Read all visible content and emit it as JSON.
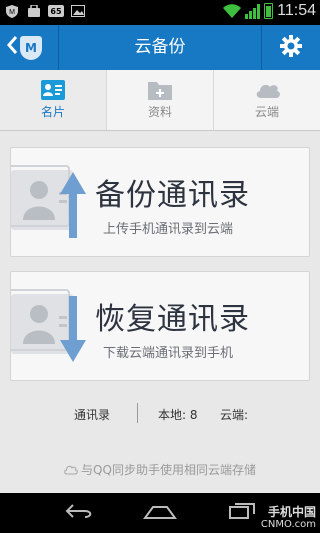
{
  "status_bar": {
    "time": "11:54",
    "badge_text": "65"
  },
  "header": {
    "title": "云备份",
    "logo_text": "M",
    "back_icon": "chevron-left-icon",
    "settings_icon": "gear-icon"
  },
  "tabs": [
    {
      "label": "名片",
      "icon": "contact-card-icon",
      "active": true
    },
    {
      "label": "资料",
      "icon": "folder-icon",
      "active": false
    },
    {
      "label": "云端",
      "icon": "cloud-icon",
      "active": false
    }
  ],
  "backup_card": {
    "title": "备份通讯录",
    "subtitle": "上传手机通讯录到云端"
  },
  "restore_card": {
    "title": "恢复通讯录",
    "subtitle": "下载云端通讯录到手机"
  },
  "stats": {
    "contacts_label": "通讯录",
    "local_label": "本地: 8",
    "cloud_label": "云端:"
  },
  "sync_note": "与QQ同步助手使用相同云端存储",
  "watermark": {
    "line1": "手机中国",
    "line2": "CNMO.com"
  },
  "colors": {
    "primary": "#1779c4",
    "text_dark": "#2d3440",
    "arrow": "#6f9fd0"
  }
}
